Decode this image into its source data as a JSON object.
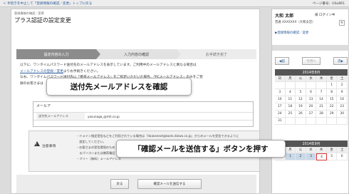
{
  "topbar": {
    "back_link": "＜ 手続きを中止して「登録情報の確認／変更」トップに戻る",
    "page_number": "ページ番号：USo861"
  },
  "main": {
    "breadcrumb": "登録情報の確認／変更",
    "title": "プラス認証の設定変更",
    "steps": [
      {
        "label": "設定内容の入力",
        "active": true
      },
      {
        "label": "入力内容の確認",
        "active": false
      },
      {
        "label": "お手続き完了",
        "active": false
      }
    ],
    "intro": {
      "line1": "以下に、ワンタイムパスワード送付先のメールアドレスを表示しています。ご利用中のメールアドレスと異なる場合は",
      "line2_link": "メールアドレスの登録／変更",
      "line2_rest": "よりお手続きください。",
      "line3": "なお、ワンタイムパスワード送付先に「携帯メールアドレス」をご指定いただいた場合、「PCメールアドレス」のみをご登",
      "line4": "録のお客さまは"
    },
    "info_box": {
      "heading": "メールア",
      "row_label": "送付先メールアドレス",
      "row_value": "yasunaga_@mti.co.jp"
    },
    "note": {
      "label": "注意事項",
      "line1": "・ドメイン指定受信などをご利用されている場合は「daiwanext@bank.daiwa.co.jp」からのメールを受信できるように",
      "line2": "　設定してください。",
      "line3": "・お客さまの受信環境のため",
      "line4": "　るパソコンまたは携帯電話",
      "line5": "・フリー（無料）メールアドレス"
    },
    "buttons": {
      "back": "戻る",
      "send": "確認メールを送信する"
    }
  },
  "callouts": {
    "c1": "送付先メールアドレスを確認",
    "c2": "「確認メールを送信する」ボタンを押す"
  },
  "sidebar": {
    "user_name": "大和 太郎",
    "login_label": "様 ログイン中",
    "account": "普通 XXXXXXX（大和支店）",
    "logout_icon": "×",
    "link": "▶登録情報の確認／変更",
    "nav": {
      "prev": "◀前",
      "current": "今月へ",
      "next": "次▶"
    },
    "weekday_headers": [
      "日",
      "月",
      "火",
      "水",
      "木",
      "金",
      "土"
    ],
    "calendars": [
      {
        "caption": "2014年8月",
        "days": [
          "",
          "",
          "",
          "",
          "",
          "1",
          "2",
          "3",
          "4",
          "5",
          "6",
          "7",
          "8",
          "9",
          "10",
          "11",
          "12",
          "13",
          "14",
          "15",
          "16",
          "17",
          "18",
          "19",
          "20",
          "21",
          "22",
          "23",
          "24",
          "25",
          "26",
          "27",
          "28",
          "29",
          "30",
          "31",
          "",
          "",
          "",
          "",
          "",
          ""
        ]
      },
      {
        "caption": "2014年9月",
        "days": [
          "",
          "1",
          "2",
          "3",
          "4",
          "5",
          "6"
        ]
      }
    ]
  }
}
